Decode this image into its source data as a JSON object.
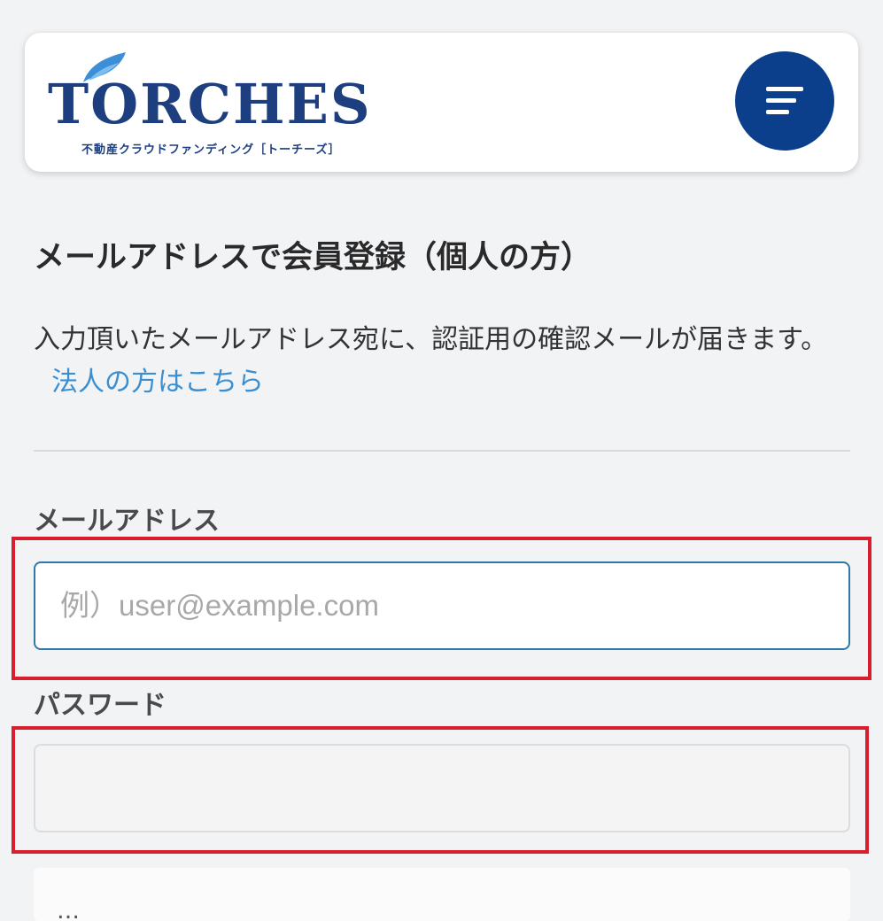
{
  "header": {
    "logo_text": "TORCHES",
    "logo_subtitle": "不動産クラウドファンディング［トーチーズ］",
    "menu_icon": "menu-icon",
    "brand_color": "#1d3f7f",
    "menu_button_color": "#0b3f8c"
  },
  "main": {
    "title": "メールアドレスで会員登録（個人の方）",
    "lead_text": "入力頂いたメールアドレス宛に、認証用の確認メールが届きます。",
    "corporate_link": "法人の方はこちら",
    "link_color": "#3b8fd0"
  },
  "form": {
    "email": {
      "label": "メールアドレス",
      "placeholder": "例）user@example.com",
      "value": ""
    },
    "password": {
      "label": "パスワード",
      "value": ""
    },
    "highlight_color": "#d81e2c"
  },
  "bottom": {
    "partial_text": "…"
  }
}
